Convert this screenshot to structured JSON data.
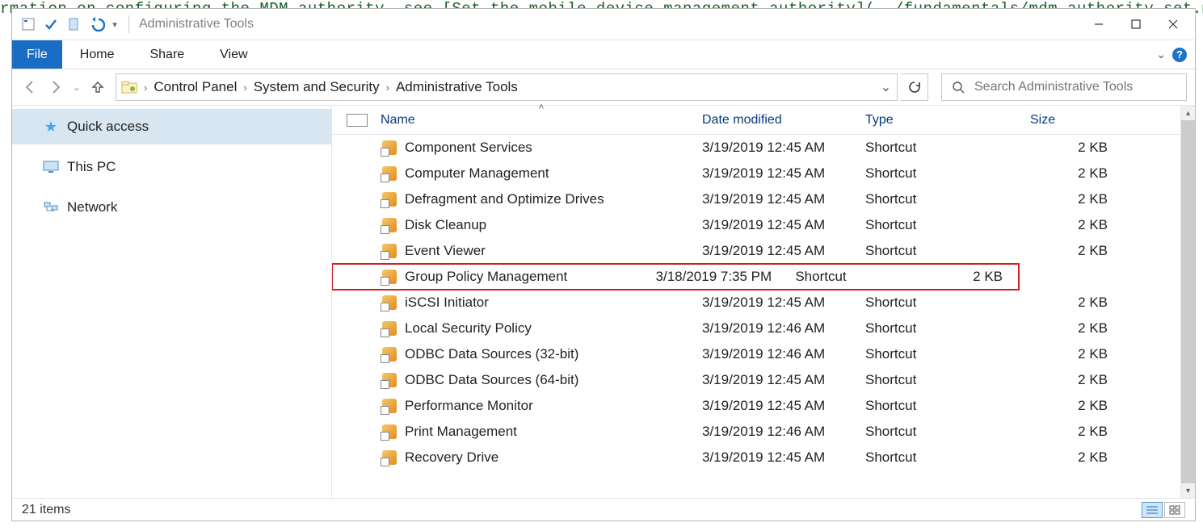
{
  "bg_text": "rmation on configuring the MDM authority, see [Set the mobile device management authority](../fundamentals/mdm-authority-set.md",
  "window": {
    "title": "Administrative Tools"
  },
  "ribbon": {
    "file": "File",
    "tabs": [
      "Home",
      "Share",
      "View"
    ]
  },
  "breadcrumbs": [
    "Control Panel",
    "System and Security",
    "Administrative Tools"
  ],
  "search": {
    "placeholder": "Search Administrative Tools"
  },
  "nav_pane": {
    "quick_access": "Quick access",
    "this_pc": "This PC",
    "network": "Network"
  },
  "columns": {
    "name": "Name",
    "date": "Date modified",
    "type": "Type",
    "size": "Size"
  },
  "files": [
    {
      "name": "Component Services",
      "date": "3/19/2019 12:45 AM",
      "type": "Shortcut",
      "size": "2 KB",
      "hl": false
    },
    {
      "name": "Computer Management",
      "date": "3/19/2019 12:45 AM",
      "type": "Shortcut",
      "size": "2 KB",
      "hl": false
    },
    {
      "name": "Defragment and Optimize Drives",
      "date": "3/19/2019 12:45 AM",
      "type": "Shortcut",
      "size": "2 KB",
      "hl": false
    },
    {
      "name": "Disk Cleanup",
      "date": "3/19/2019 12:45 AM",
      "type": "Shortcut",
      "size": "2 KB",
      "hl": false
    },
    {
      "name": "Event Viewer",
      "date": "3/19/2019 12:45 AM",
      "type": "Shortcut",
      "size": "2 KB",
      "hl": false
    },
    {
      "name": "Group Policy Management",
      "date": "3/18/2019 7:35 PM",
      "type": "Shortcut",
      "size": "2 KB",
      "hl": true
    },
    {
      "name": "iSCSI Initiator",
      "date": "3/19/2019 12:45 AM",
      "type": "Shortcut",
      "size": "2 KB",
      "hl": false
    },
    {
      "name": "Local Security Policy",
      "date": "3/19/2019 12:46 AM",
      "type": "Shortcut",
      "size": "2 KB",
      "hl": false
    },
    {
      "name": "ODBC Data Sources (32-bit)",
      "date": "3/19/2019 12:46 AM",
      "type": "Shortcut",
      "size": "2 KB",
      "hl": false
    },
    {
      "name": "ODBC Data Sources (64-bit)",
      "date": "3/19/2019 12:45 AM",
      "type": "Shortcut",
      "size": "2 KB",
      "hl": false
    },
    {
      "name": "Performance Monitor",
      "date": "3/19/2019 12:45 AM",
      "type": "Shortcut",
      "size": "2 KB",
      "hl": false
    },
    {
      "name": "Print Management",
      "date": "3/19/2019 12:46 AM",
      "type": "Shortcut",
      "size": "2 KB",
      "hl": false
    },
    {
      "name": "Recovery Drive",
      "date": "3/19/2019 12:45 AM",
      "type": "Shortcut",
      "size": "2 KB",
      "hl": false
    }
  ],
  "status": {
    "count": "21 items"
  }
}
